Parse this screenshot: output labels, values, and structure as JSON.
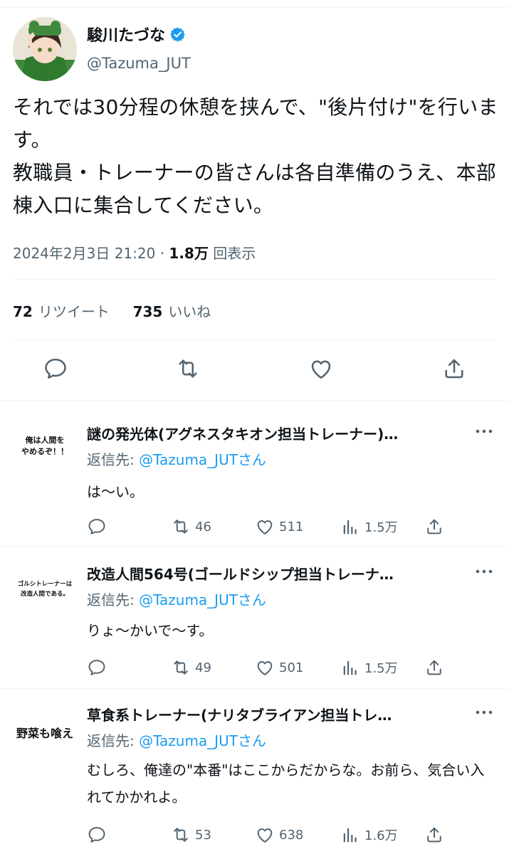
{
  "tweet": {
    "author_name": "駿川たづな",
    "author_handle": "@Tazuma_JUT",
    "text": "それでは30分程の休憩を挟んで、\"後片付け\"を行います。\n教職員・トレーナーの皆さんは各自準備のうえ、本部棟入口に集合してください。",
    "timestamp": "2024年2月3日 21:20",
    "separator": "·",
    "views_count": "1.8万",
    "views_label": "回表示",
    "retweets_count": "72",
    "retweets_label": "リツイート",
    "likes_count": "735",
    "likes_label": "いいね"
  },
  "replies": [
    {
      "avatar_text": "俺は人間を\nやめるぞ！！",
      "name": "謎の発光体(アグネスタキオン担当トレーナー)…",
      "reply_to_label": "返信先:",
      "reply_to_handle": "@Tazuma_JUTさん",
      "text": "は〜い。",
      "retweets": "46",
      "likes": "511",
      "views": "1.5万"
    },
    {
      "avatar_text": "ゴルシトレーナーは\n改造人間である。",
      "name": "改造人間564号(ゴールドシップ担当トレーナ…",
      "reply_to_label": "返信先:",
      "reply_to_handle": "@Tazuma_JUTさん",
      "text": "りょ〜かいで〜す。",
      "retweets": "49",
      "likes": "501",
      "views": "1.5万"
    },
    {
      "avatar_text": "野菜も喰え",
      "name": "草食系トレーナー(ナリタブライアン担当トレ…",
      "reply_to_label": "返信先:",
      "reply_to_handle": "@Tazuma_JUTさん",
      "text": "むしろ、俺達の\"本番\"はここからだからな。お前ら、気合い入れてかかれよ。",
      "retweets": "53",
      "likes": "638",
      "views": "1.6万"
    }
  ],
  "icons": {
    "verified": "verified-badge-icon",
    "reply": "reply-icon",
    "retweet": "retweet-icon",
    "like": "heart-icon",
    "share": "share-icon",
    "views": "analytics-icon",
    "more": "more-icon"
  },
  "colors": {
    "text": "#0f1419",
    "secondary": "#536471",
    "accent": "#1d9bf0",
    "divider": "#eff3f4"
  }
}
